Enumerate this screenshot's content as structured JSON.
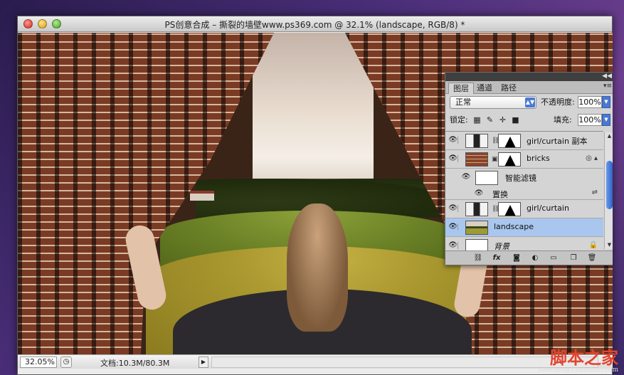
{
  "window": {
    "title": "PS创意合成 – 撕裂的墙壁www.ps369.com @ 32.1% (landscape, RGB/8) *"
  },
  "statusbar": {
    "zoom": "32.05%",
    "doc_info": "文档:10.3M/80.3M"
  },
  "layers_panel": {
    "tabs": [
      {
        "label": "图层",
        "active": true
      },
      {
        "label": "通道",
        "active": false
      },
      {
        "label": "路径",
        "active": false
      }
    ],
    "blend_mode": "正常",
    "opacity_label": "不透明度:",
    "opacity_value": "100%",
    "lock_label": "锁定:",
    "fill_label": "填充:",
    "fill_value": "100%",
    "layers": [
      {
        "name": "girl/curtain 副本",
        "visible": true,
        "has_mask": true,
        "selected": false
      },
      {
        "name": "bricks",
        "visible": true,
        "has_mask": true,
        "selected": false
      },
      {
        "name": "智能滤镜",
        "visible": true,
        "sub": true,
        "selected": false
      },
      {
        "name": "置换",
        "visible": true,
        "sub": true,
        "selected": false
      },
      {
        "name": "girl/curtain",
        "visible": true,
        "has_mask": true,
        "selected": false
      },
      {
        "name": "landscape",
        "visible": true,
        "has_mask": false,
        "selected": true
      },
      {
        "name": "背景",
        "visible": true,
        "has_mask": false,
        "locked": true,
        "selected": false
      }
    ],
    "bottom_icons": [
      "link-icon",
      "fx-icon",
      "mask-icon",
      "adjustment-icon",
      "group-icon",
      "new-layer-icon",
      "trash-icon"
    ]
  },
  "watermark": {
    "text": "脚本之家",
    "url": "jiaocheng.chazidian.com"
  },
  "colors": {
    "selection": "#a9c6ee",
    "accent": "#4a78d4"
  }
}
